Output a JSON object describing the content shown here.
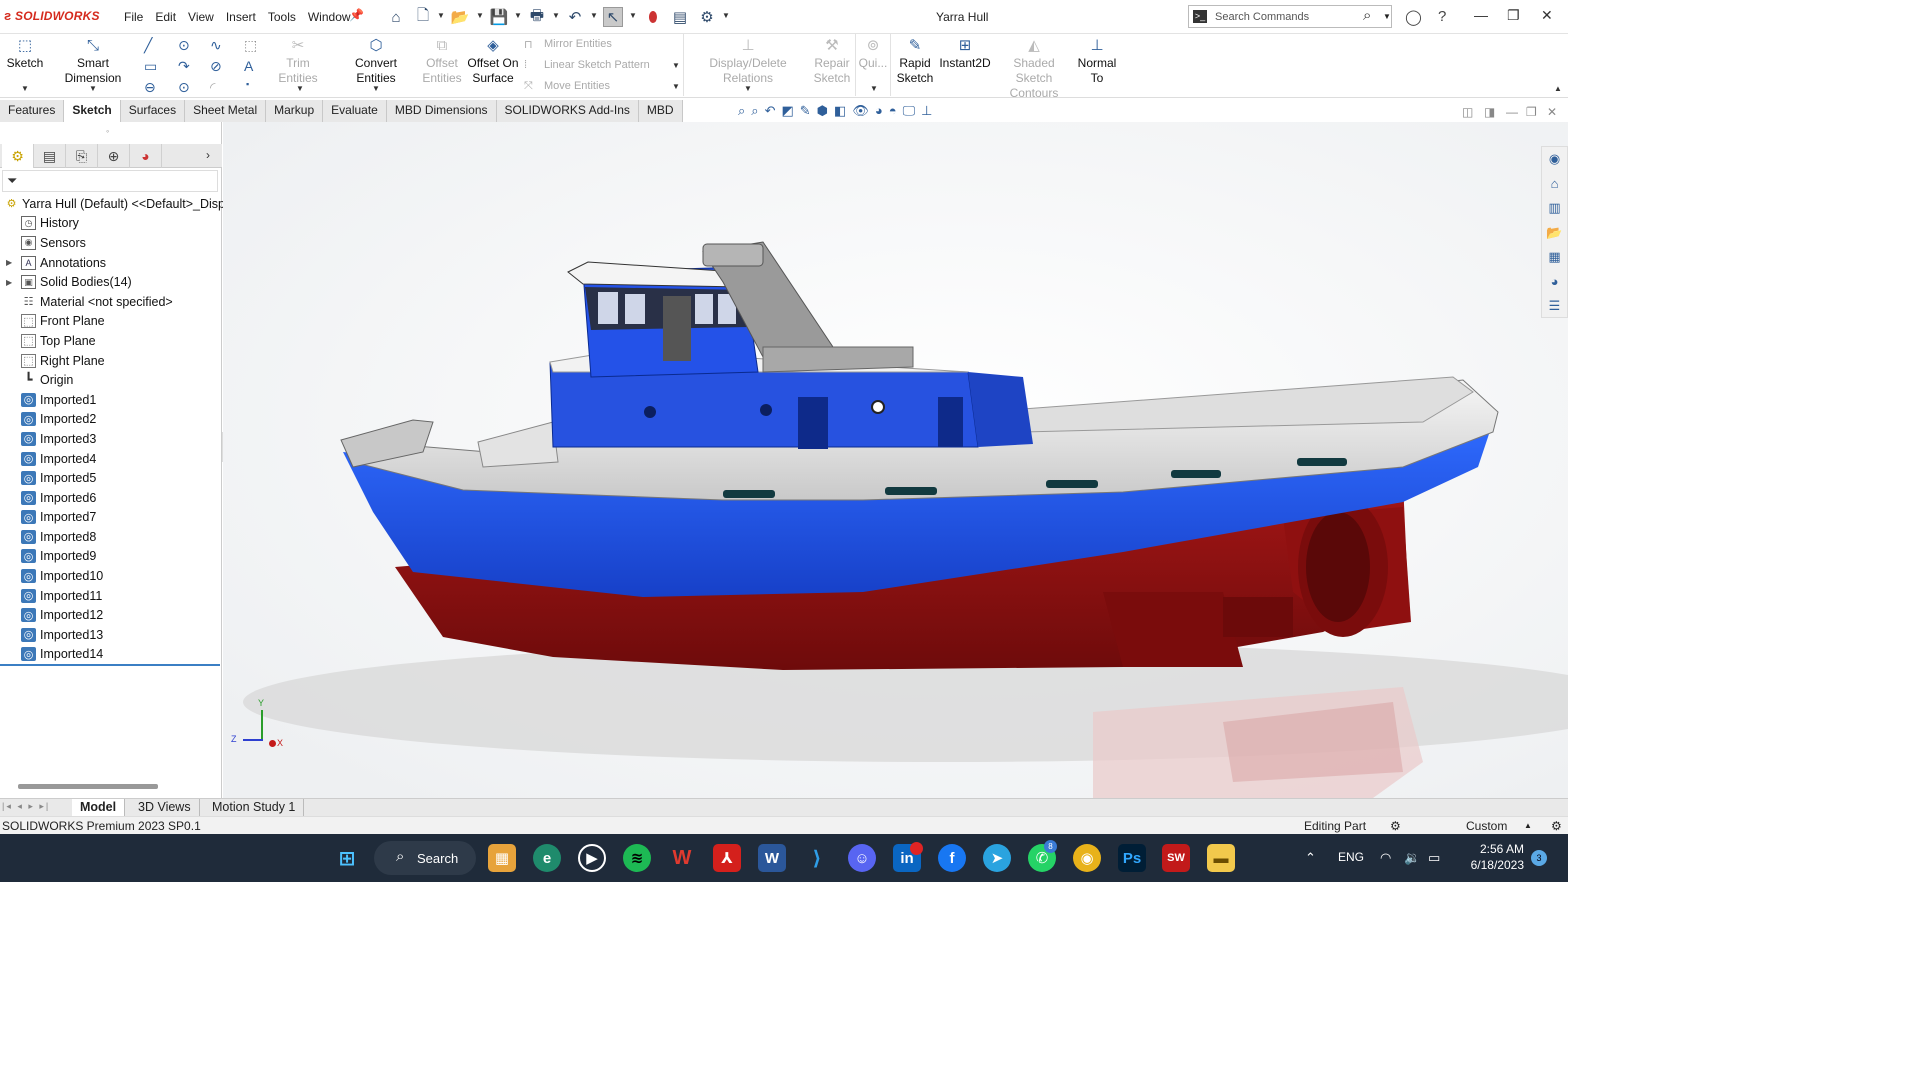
{
  "app": {
    "logo_text": "SOLIDWORKS",
    "document_title": "Yarra Hull",
    "menus": [
      "File",
      "Edit",
      "View",
      "Insert",
      "Tools",
      "Window"
    ],
    "search_placeholder": "Search Commands"
  },
  "command_manager": {
    "sketch": "Sketch",
    "smart_dimension": "Smart Dimension",
    "trim_entities": "Trim Entities",
    "convert_entities": "Convert Entities",
    "offset_entities_1": "Offset",
    "offset_entities_2": "Entities",
    "offset_on_surface_1": "Offset On",
    "offset_on_surface_2": "Surface",
    "mirror_entities": "Mirror Entities",
    "linear_sketch_pattern": "Linear Sketch Pattern",
    "move_entities": "Move Entities",
    "display_delete_relations": "Display/Delete Relations",
    "repair_sketch_1": "Repair",
    "repair_sketch_2": "Sketch",
    "quick_snaps": "Qui...",
    "rapid_sketch_1": "Rapid",
    "rapid_sketch_2": "Sketch",
    "instant2d": "Instant2D",
    "shaded_contours_1": "Shaded Sketch",
    "shaded_contours_2": "Contours",
    "normal_to_1": "Normal",
    "normal_to_2": "To"
  },
  "tabs": [
    "Features",
    "Sketch",
    "Surfaces",
    "Sheet Metal",
    "Markup",
    "Evaluate",
    "MBD Dimensions",
    "SOLIDWORKS Add-Ins",
    "MBD"
  ],
  "active_tab": "Sketch",
  "feature_tree": {
    "root": "Yarra Hull (Default) <<Default>_Disp",
    "items": [
      {
        "label": "History",
        "icon": "history-icon"
      },
      {
        "label": "Sensors",
        "icon": "sensors-icon"
      },
      {
        "label": "Annotations",
        "icon": "annotations-icon",
        "expandable": true
      },
      {
        "label": "Solid Bodies(14)",
        "icon": "solid-bodies-icon",
        "expandable": true
      },
      {
        "label": "Material <not specified>",
        "icon": "material-icon"
      },
      {
        "label": "Front Plane",
        "icon": "plane-icon"
      },
      {
        "label": "Top Plane",
        "icon": "plane-icon"
      },
      {
        "label": "Right Plane",
        "icon": "plane-icon"
      },
      {
        "label": "Origin",
        "icon": "origin-icon"
      },
      {
        "label": "Imported1",
        "icon": "imported-body-icon"
      },
      {
        "label": "Imported2",
        "icon": "imported-body-icon"
      },
      {
        "label": "Imported3",
        "icon": "imported-body-icon"
      },
      {
        "label": "Imported4",
        "icon": "imported-body-icon"
      },
      {
        "label": "Imported5",
        "icon": "imported-body-icon"
      },
      {
        "label": "Imported6",
        "icon": "imported-body-icon"
      },
      {
        "label": "Imported7",
        "icon": "imported-body-icon"
      },
      {
        "label": "Imported8",
        "icon": "imported-body-icon"
      },
      {
        "label": "Imported9",
        "icon": "imported-body-icon"
      },
      {
        "label": "Imported10",
        "icon": "imported-body-icon"
      },
      {
        "label": "Imported11",
        "icon": "imported-body-icon"
      },
      {
        "label": "Imported12",
        "icon": "imported-body-icon"
      },
      {
        "label": "Imported13",
        "icon": "imported-body-icon"
      },
      {
        "label": "Imported14",
        "icon": "imported-body-icon"
      }
    ]
  },
  "triad": {
    "x": "X",
    "y": "Y",
    "z": "Z"
  },
  "bottom_tabs": [
    "Model",
    "3D Views",
    "Motion Study 1"
  ],
  "active_bottom_tab": "Model",
  "status": {
    "product": "SOLIDWORKS Premium 2023 SP0.1",
    "mode": "Editing Part",
    "units": "Custom"
  },
  "taskbar": {
    "search_label": "Search",
    "language": "ENG",
    "time": "2:56 AM",
    "date": "6/18/2023",
    "whatsapp_badge": "8",
    "notification_count": "3",
    "sw_icon_text": "SW",
    "ps_icon_text": "Ps",
    "in_icon_text": "in"
  },
  "colors": {
    "hull_blue": "#1f4fd8",
    "hull_red": "#8a1010",
    "deck_white": "#e8e8e8",
    "accent": "#3b7fc4",
    "logo_red": "#d52b1e"
  }
}
